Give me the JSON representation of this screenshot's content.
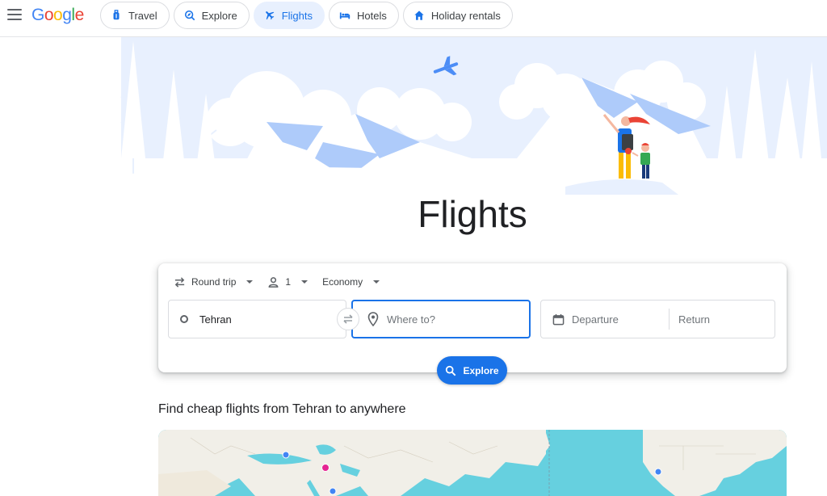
{
  "header": {
    "logo": [
      "G",
      "o",
      "o",
      "g",
      "l",
      "e"
    ],
    "tabs": [
      {
        "label": "Travel",
        "icon": "luggage-icon"
      },
      {
        "label": "Explore",
        "icon": "explore-icon"
      },
      {
        "label": "Flights",
        "icon": "airplane-icon",
        "active": true
      },
      {
        "label": "Hotels",
        "icon": "bed-icon"
      },
      {
        "label": "Holiday rentals",
        "icon": "house-icon"
      }
    ]
  },
  "hero": {
    "title": "Flights"
  },
  "search": {
    "trip_type": "Round trip",
    "passengers": "1",
    "cabin_class": "Economy",
    "from_value": "Tehran",
    "to_placeholder": "Where to?",
    "departure_placeholder": "Departure",
    "return_placeholder": "Return",
    "explore_label": "Explore"
  },
  "section": {
    "title": "Find cheap flights from Tehran to anywhere"
  },
  "colors": {
    "accent": "#1a73e8",
    "active_chip_bg": "#e8f0fe",
    "map_water": "#66d0df",
    "map_land": "#f1efe8"
  }
}
